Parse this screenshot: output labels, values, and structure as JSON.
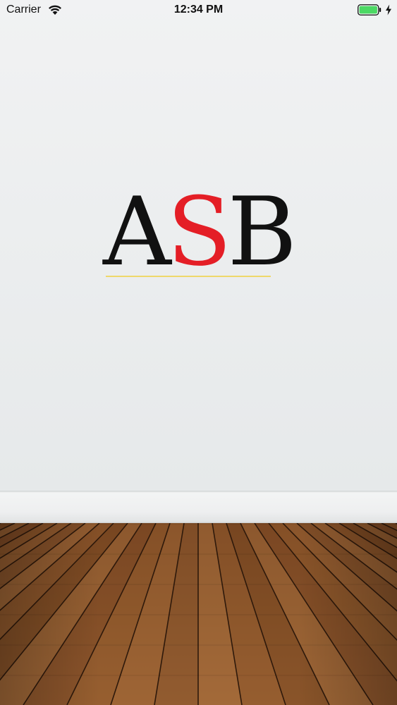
{
  "status_bar": {
    "carrier": "Carrier",
    "time": "12:34 PM",
    "wifi_icon": "wifi-icon",
    "battery_icon": "battery-icon",
    "charging_icon": "charging-bolt-icon"
  },
  "logo": {
    "letters": [
      "A",
      "S",
      "B"
    ],
    "letter_colors": [
      "#111111",
      "#e41e26",
      "#111111"
    ],
    "underline_color": "#efd86a"
  },
  "colors": {
    "battery_fill": "#4cd964",
    "wall": "#eceeef",
    "floor": "#8a5328"
  }
}
